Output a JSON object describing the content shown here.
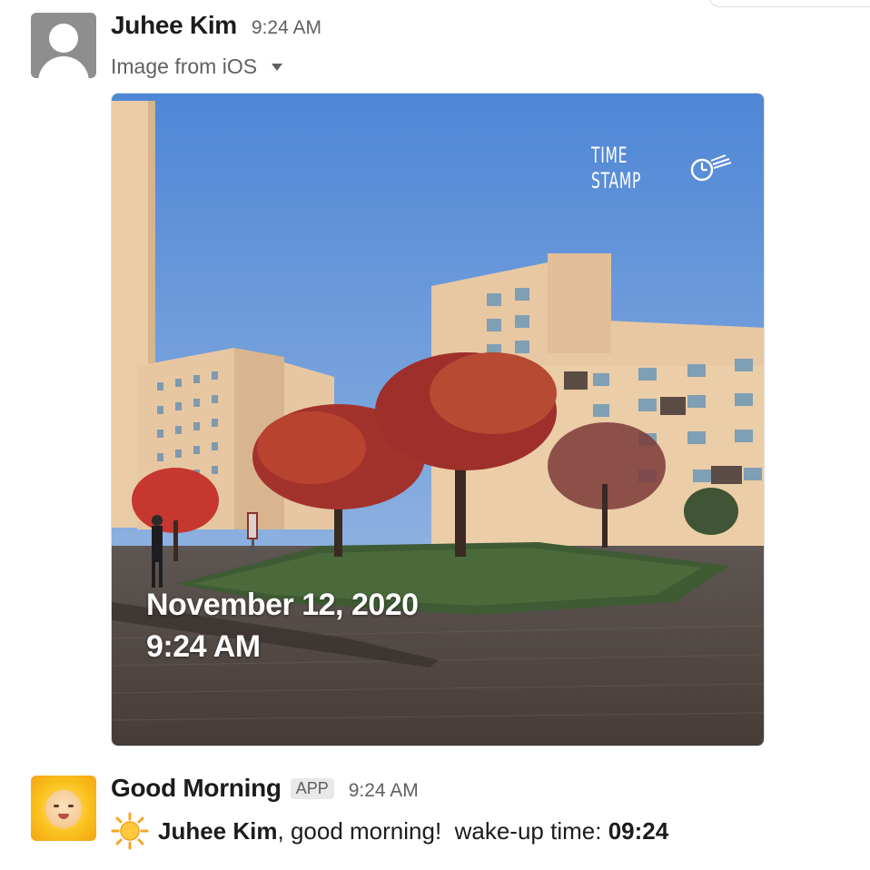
{
  "messages": [
    {
      "author": "Juhee Kim",
      "time": "9:24 AM",
      "file_title": "Image from iOS",
      "attachment": {
        "stamp_logo": "TIME STAMP",
        "stamp_date": "November 12, 2020",
        "stamp_time": "9:24 AM"
      }
    },
    {
      "author": "Good Morning",
      "badge": "APP",
      "time": "9:24 AM",
      "body": {
        "mention": "Juhee Kim",
        "text": ", good morning!  wake-up time: ",
        "wake_time": "09:24"
      }
    }
  ],
  "colors": {
    "author": "#1d1c1d",
    "meta": "#616061",
    "badge_bg": "#e8e8e8",
    "sky": "#5b8fd8",
    "building": "#e8c9a6",
    "foliage": "#a8332a"
  },
  "icons": [
    "user-avatar-icon",
    "caret-down-icon",
    "clock-icon",
    "sun-emoji-icon"
  ]
}
